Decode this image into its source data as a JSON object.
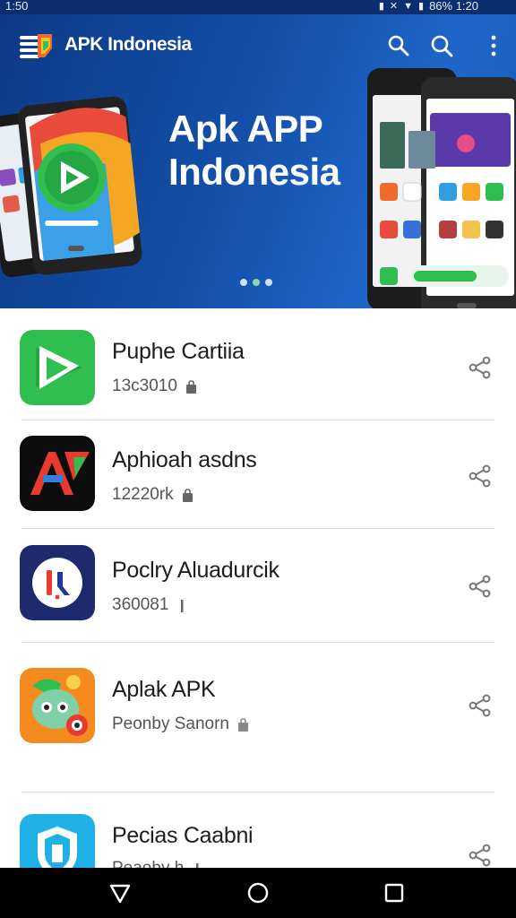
{
  "status_bar": {
    "time": "1:50",
    "right_text": "86% 1:20",
    "icons": [
      "vibrate-icon",
      "wifi-off-icon",
      "signal-icon",
      "battery-icon"
    ]
  },
  "toolbar": {
    "title": "APK Indonesia",
    "icons": [
      "app-logo-icon",
      "search-icon",
      "search-icon",
      "more-vert-icon"
    ]
  },
  "hero": {
    "headline_line1": "Apk APP",
    "headline_line2": "Indonesia",
    "dots": 3,
    "active_dot": 1
  },
  "apps": [
    {
      "name": "Puphe Cartiia",
      "meta": "13c3010",
      "icon": "play-arrow-app-icon",
      "meta_icon": "lock-icon"
    },
    {
      "name": "Aphioah asdns",
      "meta": "12220rk",
      "icon": "a-letter-app-icon",
      "meta_icon": "lock-icon"
    },
    {
      "name": "Poclry Aluadurcik",
      "meta": "360081",
      "icon": "blue-circle-app-icon",
      "meta_icon": "bar-icon"
    },
    {
      "name": "Aplak APK",
      "meta": "Peonby Sanorn",
      "icon": "cartoon-face-app-icon",
      "meta_icon": "lock-icon"
    },
    {
      "name": "Pecias Caabni",
      "meta": "Peaoby h",
      "icon": "shield-app-icon",
      "meta_icon": "bar-icon"
    }
  ],
  "nav": {
    "icons": [
      "back-icon",
      "home-icon",
      "recents-icon"
    ]
  },
  "colors": {
    "hero_dark": "#0d3a86",
    "hero_light": "#1e66c9",
    "accent_green": "#2fbe4f",
    "divider": "#dcdcdc"
  }
}
